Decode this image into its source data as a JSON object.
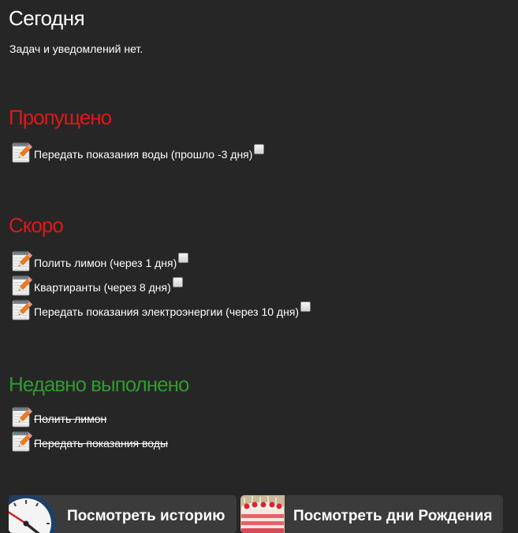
{
  "today": {
    "title": "Сегодня",
    "empty_note": "Задач и уведомлений нет."
  },
  "missed": {
    "title": "Пропущено",
    "items": [
      {
        "label": "Передать показания воды (прошло -3 дня)"
      }
    ]
  },
  "soon": {
    "title": "Скоро",
    "items": [
      {
        "label": "Полить лимон (через 1 дня)"
      },
      {
        "label": "Квартиранты (через 8 дня)"
      },
      {
        "label": "Передать показания электроэнергии (через 10 дня)"
      }
    ]
  },
  "done": {
    "title": "Недавно выполнено",
    "items": [
      {
        "label": "Полить лимон"
      },
      {
        "label": "Передать показания воды"
      }
    ]
  },
  "buttons": {
    "history": "Посмотреть историю",
    "birthdays": "Посмотреть дни Рождения"
  },
  "colors": {
    "background": "#262626",
    "overdue": "#e01818",
    "completed": "#2f9a2f",
    "button": "#3b3b3b"
  },
  "icons": {
    "task": "notepad-pencil-icon",
    "history": "clock-icon",
    "birthdays": "birthday-cake-icon"
  }
}
